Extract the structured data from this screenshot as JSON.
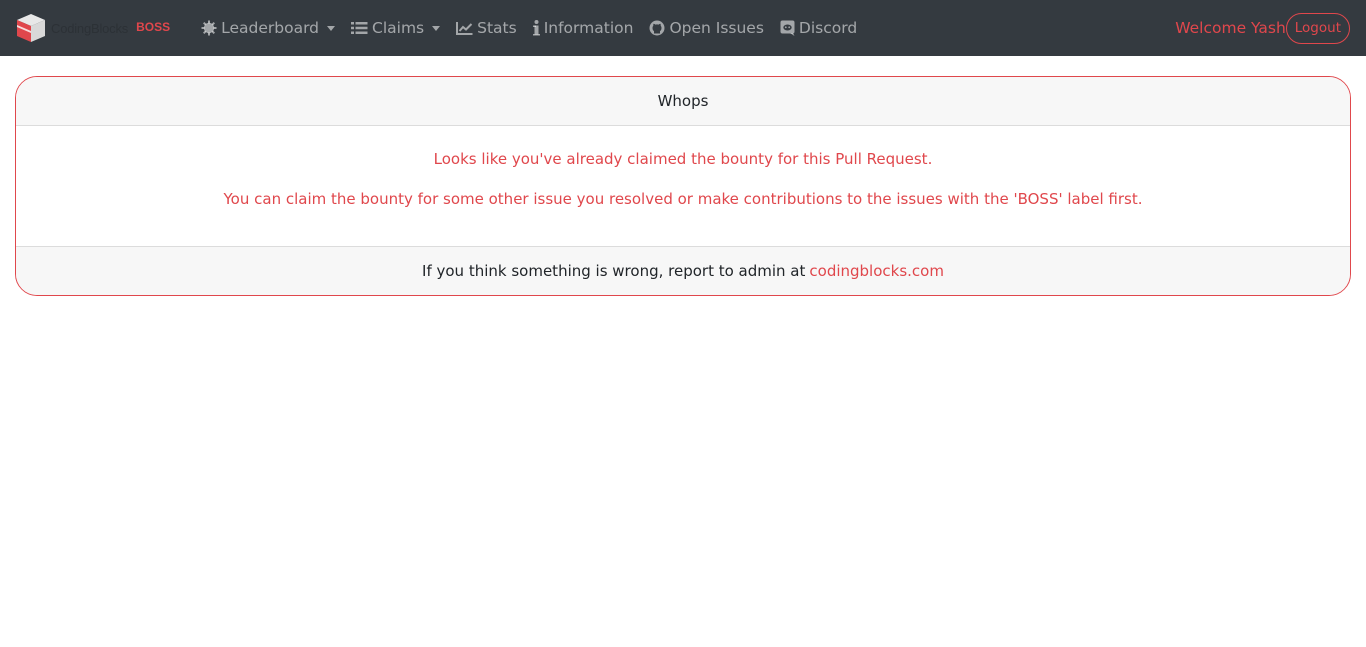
{
  "brand": {
    "logo_icon": "cube-logo-icon",
    "name": "CodingBlocks",
    "product": "BOSS",
    "accent_color": "#e0474c"
  },
  "nav": {
    "items": [
      {
        "label": "Leaderboard",
        "icon": "gear-icon",
        "dropdown": true
      },
      {
        "label": "Claims",
        "icon": "list-icon",
        "dropdown": true
      },
      {
        "label": "Stats",
        "icon": "chart-line-icon",
        "dropdown": false
      },
      {
        "label": "Information",
        "icon": "info-icon",
        "dropdown": false
      },
      {
        "label": "Open Issues",
        "icon": "github-icon",
        "dropdown": false
      },
      {
        "label": "Discord",
        "icon": "discord-icon",
        "dropdown": false
      }
    ],
    "welcome": "Welcome Yash",
    "logout_label": "Logout"
  },
  "card": {
    "header": "Whops",
    "message_1": "Looks like you've already claimed the bounty for this Pull Request.",
    "message_2": "You can claim the bounty for some other issue you resolved or make contributions to the issues with the 'BOSS' label first.",
    "footer_text": "If you think something is wrong, report to admin at",
    "footer_link": "codingblocks.com"
  }
}
